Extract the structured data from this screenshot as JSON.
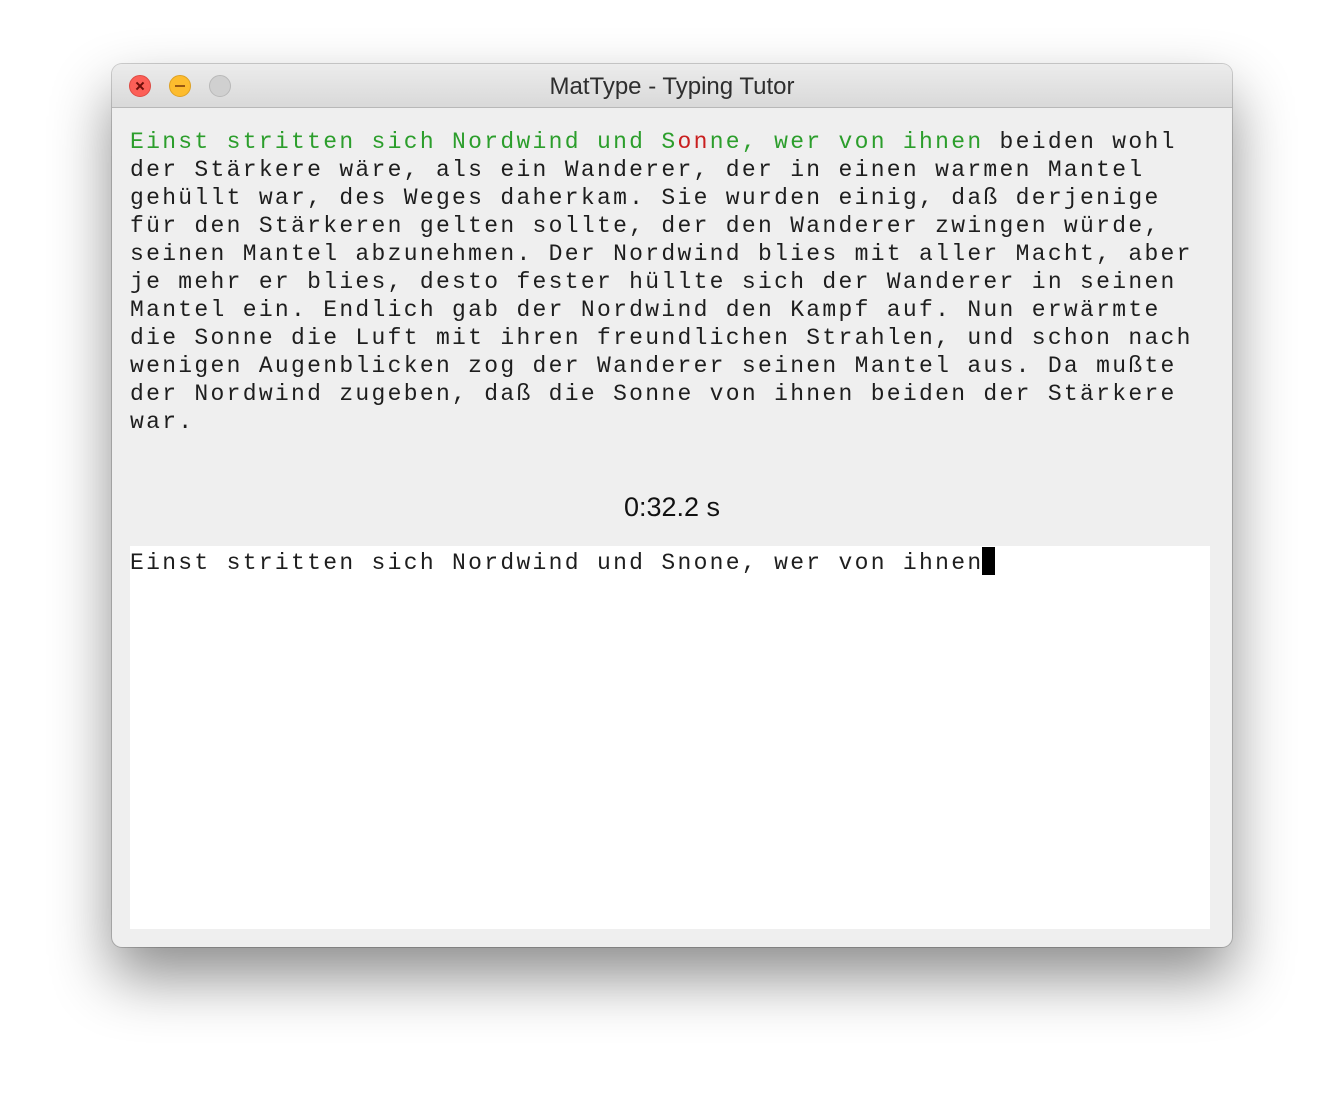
{
  "window": {
    "title": "MatType - Typing Tutor"
  },
  "reference": {
    "typed_correct_1": "Einst stritten sich Nordwind und S",
    "error_chars": "on",
    "typed_correct_2": "ne, wer von ihnen",
    "remaining": " beiden wohl\nder Stärkere wäre, als ein Wanderer, der in einen warmen Mantel\ngehüllt war, des Weges daherkam. Sie wurden einig, daß derjenige\nfür den Stärkeren gelten sollte, der den Wanderer zwingen würde,\nseinen Mantel abzunehmen. Der Nordwind blies mit aller Macht, aber\nje mehr er blies, desto fester hüllte sich der Wanderer in seinen\nMantel ein. Endlich gab der Nordwind den Kampf auf. Nun erwärmte\ndie Sonne die Luft mit ihren freundlichen Strahlen, und schon nach\nwenigen Augenblicken zog der Wanderer seinen Mantel aus. Da mußte\nder Nordwind zugeben, daß die Sonne von ihnen beiden der Stärkere\nwar."
  },
  "timer": {
    "value": "0:32.2 s"
  },
  "input": {
    "value": "Einst stritten sich Nordwind und Snone, wer von ihnen"
  },
  "colors": {
    "correct": "#2c9e2c",
    "error": "#c91f1f",
    "text": "#1e1e1e",
    "close_button": "#fc5f57",
    "minimize_button": "#fdbc2e",
    "zoom_button": "#d0d0d0"
  }
}
